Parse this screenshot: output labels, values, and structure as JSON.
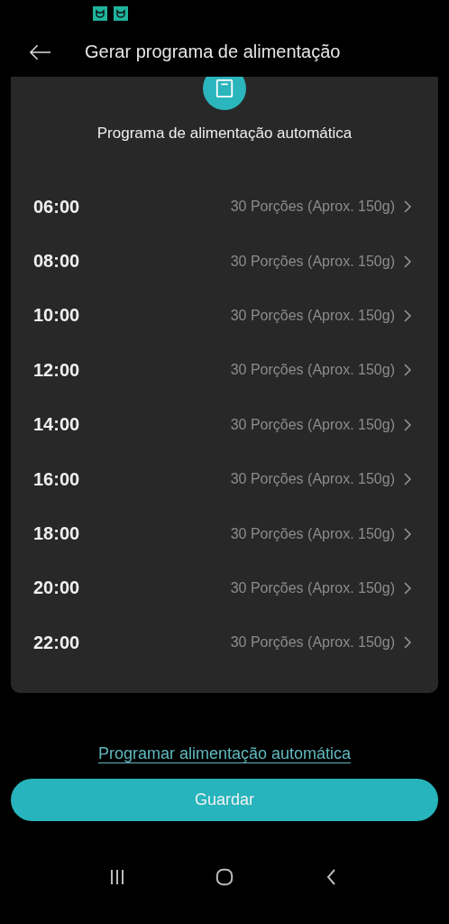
{
  "header": {
    "title": "Gerar programa de alimentação"
  },
  "card": {
    "title": "Programa de alimentação automática",
    "schedule": [
      {
        "time": "06:00",
        "portions": "30 Porções (Aprox. 150g)"
      },
      {
        "time": "08:00",
        "portions": "30 Porções (Aprox. 150g)"
      },
      {
        "time": "10:00",
        "portions": "30 Porções (Aprox. 150g)"
      },
      {
        "time": "12:00",
        "portions": "30 Porções (Aprox. 150g)"
      },
      {
        "time": "14:00",
        "portions": "30 Porções (Aprox. 150g)"
      },
      {
        "time": "16:00",
        "portions": "30 Porções (Aprox. 150g)"
      },
      {
        "time": "18:00",
        "portions": "30 Porções (Aprox. 150g)"
      },
      {
        "time": "20:00",
        "portions": "30 Porções (Aprox. 150g)"
      },
      {
        "time": "22:00",
        "portions": "30 Porções (Aprox. 150g)"
      }
    ]
  },
  "link": "Programar alimentação automática",
  "button": "Guardar"
}
